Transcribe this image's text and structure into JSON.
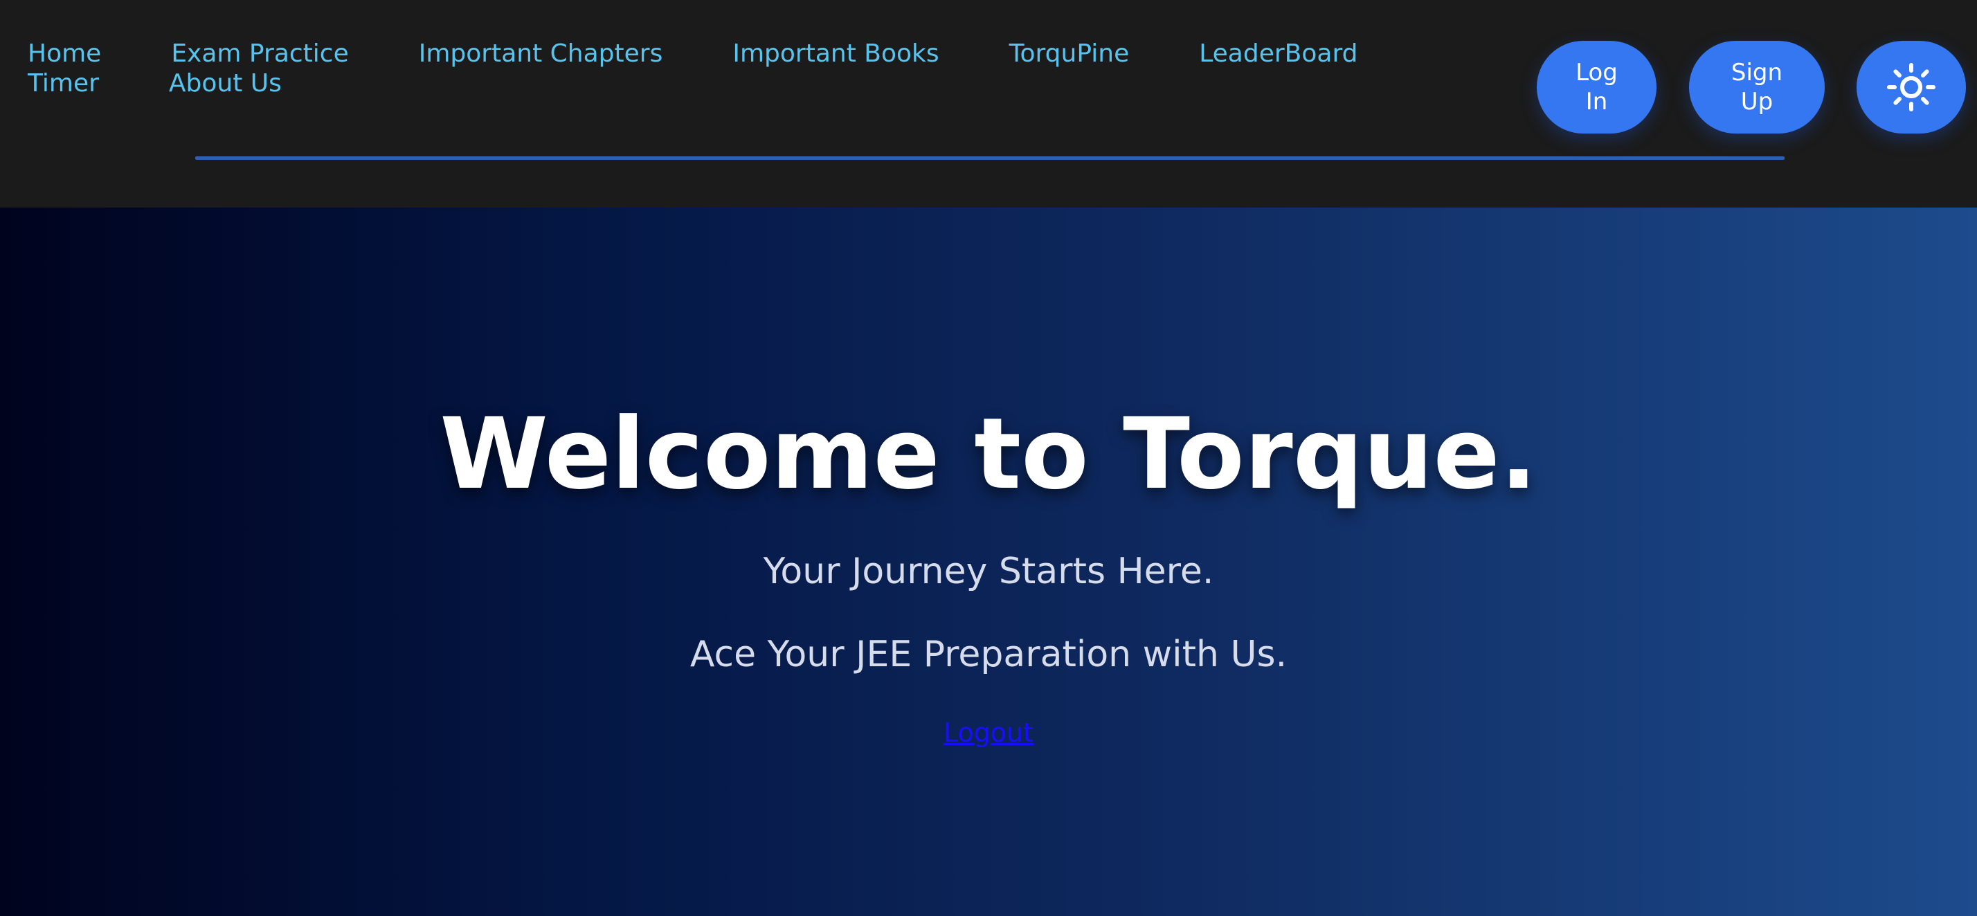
{
  "nav": {
    "links": [
      "Home",
      "Exam Practice",
      "Important Chapters",
      "Important Books",
      "TorquPine",
      "LeaderBoard",
      "Timer",
      "About Us"
    ],
    "link_color": "#58c4ee"
  },
  "auth": {
    "login_label": "Log In",
    "signup_label": "Sign Up",
    "button_color": "#3577f0"
  },
  "theme_toggle": {
    "icon": "sun-icon"
  },
  "hero": {
    "title": "Welcome to Torque.",
    "subtitle": "Your Journey Starts Here.",
    "tagline": "Ace Your JEE Preparation with Us.",
    "logout_label": "Logout"
  }
}
